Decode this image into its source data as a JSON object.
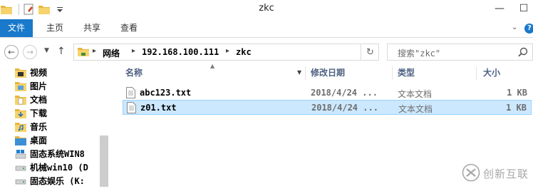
{
  "window": {
    "title": "zkc"
  },
  "ribbon": {
    "tabs": [
      {
        "label": "文件"
      },
      {
        "label": "主页"
      },
      {
        "label": "共享"
      },
      {
        "label": "查看"
      }
    ]
  },
  "address": {
    "parts": [
      "网络",
      "192.168.100.111",
      "zkc"
    ]
  },
  "search": {
    "placeholder": "搜索\"zkc\""
  },
  "nav_pane": {
    "items": [
      {
        "label": "视频",
        "icon": "video-folder-icon"
      },
      {
        "label": "图片",
        "icon": "pictures-folder-icon"
      },
      {
        "label": "文档",
        "icon": "documents-folder-icon"
      },
      {
        "label": "下载",
        "icon": "downloads-folder-icon"
      },
      {
        "label": "音乐",
        "icon": "music-folder-icon"
      },
      {
        "label": "桌面",
        "icon": "desktop-folder-icon"
      },
      {
        "label": "固态系统WIN8",
        "icon": "system-drive-icon"
      },
      {
        "label": "机械win10 (D",
        "icon": "drive-icon"
      },
      {
        "label": "固态娱乐 (K:",
        "icon": "drive-icon"
      }
    ]
  },
  "columns": {
    "name": "名称",
    "date": "修改日期",
    "type": "类型",
    "size": "大小"
  },
  "files": [
    {
      "name": "abc123.txt",
      "date": "2018/4/24 ...",
      "type": "文本文档",
      "size": "1 KB",
      "selected": false
    },
    {
      "name": "z01.txt",
      "date": "2018/4/24 ...",
      "type": "文本文档",
      "size": "1 KB",
      "selected": true
    }
  ],
  "watermark": {
    "text": "创新互联"
  },
  "colors": {
    "file_tab": "#1979ca",
    "selection_fill": "#cce8ff",
    "selection_border": "#99d1ff",
    "header_text": "#4d6082"
  }
}
